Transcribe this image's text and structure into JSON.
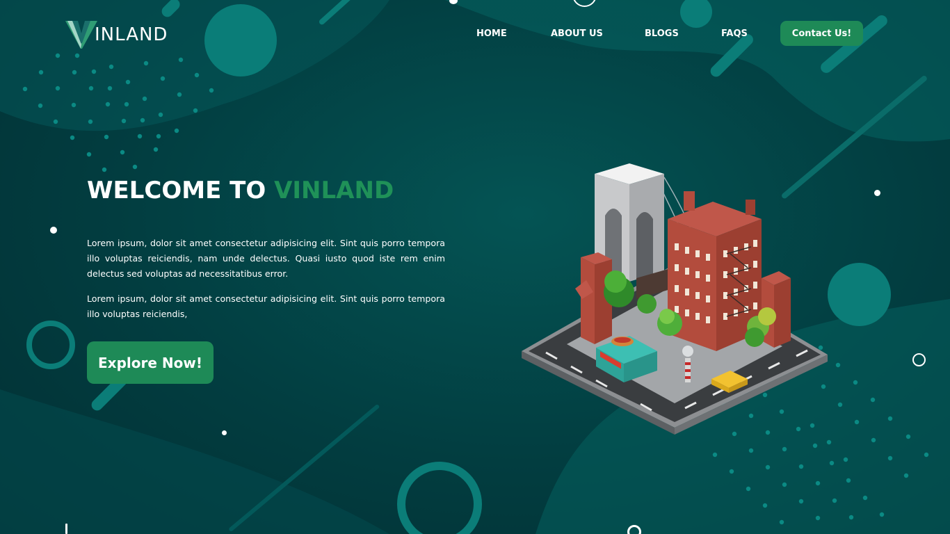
{
  "brand": {
    "logo_text": "INLAND",
    "accent_color": "#1f9158",
    "button_color": "#1e8a57"
  },
  "nav": {
    "items": [
      {
        "label": "HOME"
      },
      {
        "label": "ABOUT US"
      },
      {
        "label": "BLOGS"
      },
      {
        "label": "FAQS"
      }
    ],
    "contact_label": "Contact Us!"
  },
  "hero": {
    "title_prefix": "WELCOME TO",
    "title_accent": "VINLAND",
    "paragraph_1": "Lorem ipsum, dolor sit amet consectetur adipisicing elit. Sint quis porro tempora illo voluptas reiciendis, nam unde delectus. Quasi iusto quod iste rem enim delectus sed voluptas ad necessitatibus error.",
    "paragraph_2": "Lorem ipsum, dolor sit amet consectetur adipisicing elit. Sint quis porro tempora illo voluptas reiciendis,",
    "cta_label": "Explore Now!"
  },
  "illustration": {
    "icon": "isometric-city-block-illustration"
  }
}
